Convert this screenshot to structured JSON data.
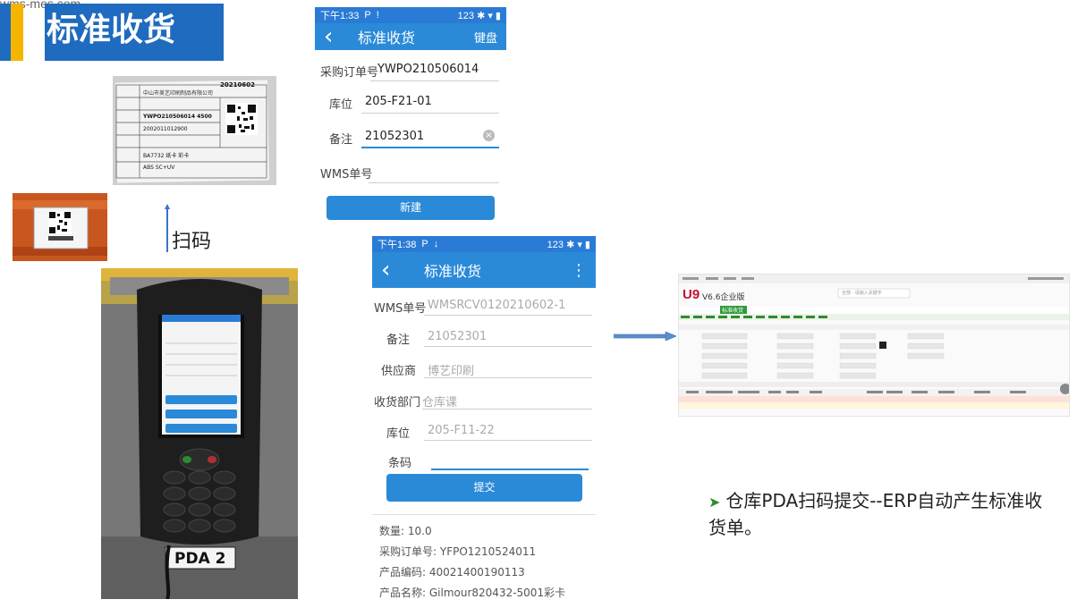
{
  "watermark": "wms-mes.com",
  "slide_title": "标准收货",
  "label_doc": {
    "rows": [
      {
        "k": "中山市",
        "v": "中山市美艺印刷制品有限公司"
      },
      {
        "k": "订单号",
        "v": "YWPO210506014   4500"
      },
      {
        "k": "料号",
        "v": "2002011012900"
      },
      {
        "k": "批号",
        "v": "20210602"
      },
      {
        "k": "品名",
        "v": "BA7732 纸卡 彩卡"
      },
      {
        "k": "",
        "v": "ABS SC+UV"
      }
    ]
  },
  "scan_label": "扫码",
  "pda_label": "PDA 2",
  "screen1": {
    "status_time": "下午1:33",
    "status_right": "123 ✱ ▾ ▮",
    "title": "标准收货",
    "action": "键盘",
    "fields": [
      {
        "label": "采购订单号",
        "value": "YWPO210506014"
      },
      {
        "label": "库位",
        "value": "205-F21-01"
      },
      {
        "label": "备注",
        "value": "21052301"
      },
      {
        "label": "WMS单号",
        "value": ""
      }
    ],
    "button": "新建"
  },
  "screen2": {
    "status_time": "下午1:38",
    "status_right": "123 ✱ ▾ ▮",
    "title": "标准收货",
    "fields": [
      {
        "label": "WMS单号",
        "value": "WMSRCV0120210602-1"
      },
      {
        "label": "备注",
        "value": "21052301"
      },
      {
        "label": "供应商",
        "value": "博艺印刷"
      },
      {
        "label": "收货部门",
        "value": "仓库课"
      },
      {
        "label": "库位",
        "value": "205-F11-22"
      },
      {
        "label": "条码",
        "value": ""
      }
    ],
    "button": "提交",
    "info": [
      "数量: 10.0",
      "采购订单号: YFPO1210524011",
      "产品编码: 40021400190113",
      "产品名称: Gilmour820432-5001彩卡"
    ]
  },
  "erp": {
    "logo": "U9",
    "version": "V6.6企业版",
    "tab": "标准收货",
    "search_placeholder": "全部 · 请输入关键字"
  },
  "bullet_text": "仓库PDA扫码提交--ERP自动产生标准收货单。",
  "colors": {
    "brand_blue": "#1f6bbf",
    "accent_yellow": "#f5b400",
    "app_blue": "#2a8ad8",
    "bullet_green": "#2e8b2e"
  }
}
